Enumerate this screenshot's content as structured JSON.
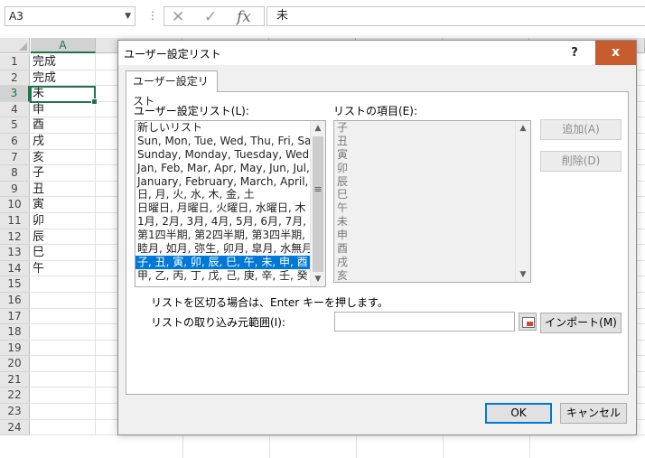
{
  "formula_bar": {
    "name_box": "A3",
    "cancel_icon": "✕",
    "enter_icon": "✓",
    "fx_icon": "fx",
    "value": "未"
  },
  "grid": {
    "column_a": "A",
    "rows": [
      {
        "num": "1",
        "a": "完成"
      },
      {
        "num": "2",
        "a": "完成"
      },
      {
        "num": "3",
        "a": "未"
      },
      {
        "num": "4",
        "a": "申"
      },
      {
        "num": "5",
        "a": "酉"
      },
      {
        "num": "6",
        "a": "戌"
      },
      {
        "num": "7",
        "a": "亥"
      },
      {
        "num": "8",
        "a": "子"
      },
      {
        "num": "9",
        "a": "丑"
      },
      {
        "num": "10",
        "a": "寅"
      },
      {
        "num": "11",
        "a": "卯"
      },
      {
        "num": "12",
        "a": "辰"
      },
      {
        "num": "13",
        "a": "巳"
      },
      {
        "num": "14",
        "a": "午"
      },
      {
        "num": "15",
        "a": ""
      },
      {
        "num": "16",
        "a": ""
      },
      {
        "num": "17",
        "a": ""
      },
      {
        "num": "18",
        "a": ""
      },
      {
        "num": "19",
        "a": ""
      },
      {
        "num": "20",
        "a": ""
      },
      {
        "num": "21",
        "a": ""
      },
      {
        "num": "22",
        "a": ""
      },
      {
        "num": "23",
        "a": ""
      },
      {
        "num": "24",
        "a": ""
      }
    ]
  },
  "dialog": {
    "title": "ユーザー設定リスト",
    "help": "?",
    "close": "x",
    "tab": "ユーザー設定リスト",
    "lists_label": "ユーザー設定リスト(L):",
    "lists": [
      "新しいリスト",
      "Sun, Mon, Tue, Wed, Thu, Fri, Sa",
      "Sunday, Monday, Tuesday, Wedn",
      "Jan, Feb, Mar, Apr, May, Jun, Jul,",
      "January, February, March, April,",
      "日, 月, 火, 水, 木, 金, 土",
      "日曜日, 月曜日, 火曜日, 水曜日, 木",
      "1月, 2月, 3月, 4月, 5月, 6月, 7月,",
      "第1四半期, 第2四半期, 第3四半期,",
      "睦月, 如月, 弥生, 卯月, 皐月, 水無月",
      "子, 丑, 寅, 卯, 辰, 巳, 午, 未, 申, 酉",
      "甲, 乙, 丙, 丁, 戊, 己, 庚, 辛, 壬, 癸"
    ],
    "selected_index": 10,
    "entries_label": "リストの項目(E):",
    "entries": [
      "子",
      "丑",
      "寅",
      "卯",
      "辰",
      "巳",
      "午",
      "未",
      "申",
      "酉",
      "戌",
      "亥"
    ],
    "add_button": "追加(A)",
    "delete_button": "削除(D)",
    "hint": "リストを区切る場合は、Enter キーを押します。",
    "import_label": "リストの取り込み元範囲(I):",
    "import_value": "",
    "import_button": "インポート(M)",
    "ok_button": "OK",
    "cancel_button": "キャンセル"
  }
}
